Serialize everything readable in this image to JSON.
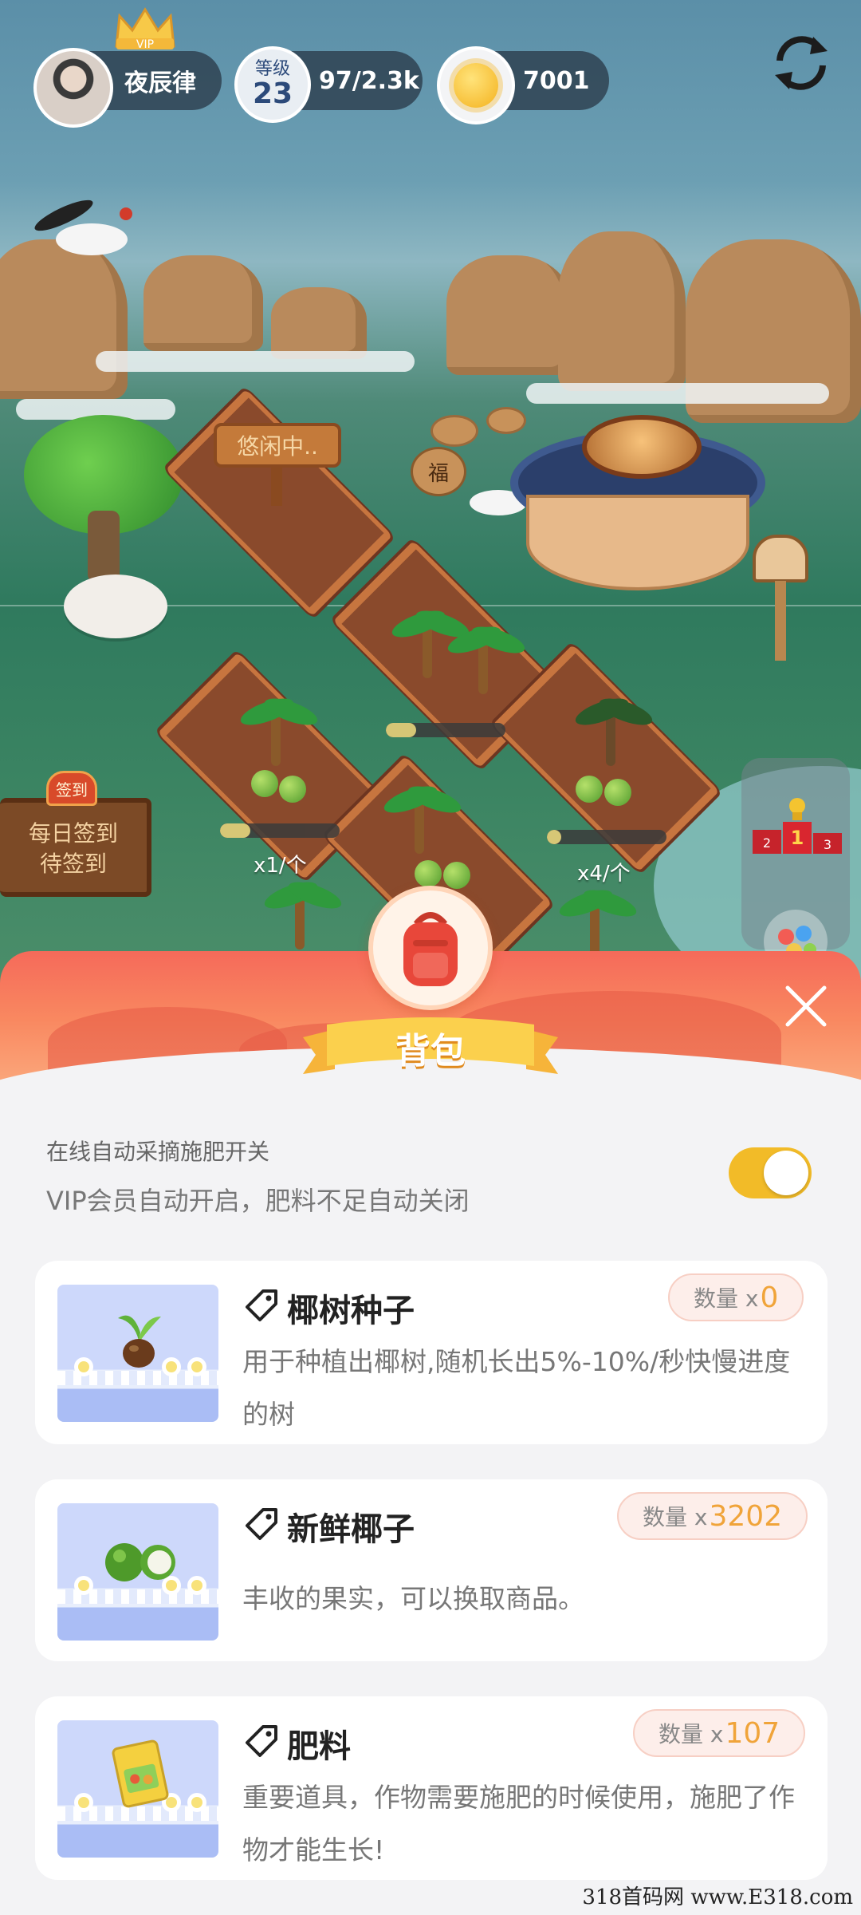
{
  "player": {
    "vip_label": "VIP",
    "name": "夜辰律",
    "level_label": "等级",
    "level": "23",
    "exp": "97/2.3k",
    "coins": "7001"
  },
  "scene": {
    "idle_sign": "悠闲中..",
    "fu_stone": "福",
    "per_label_left": "x1/个",
    "per_label_right": "x4/个",
    "checkin_tag": "签到",
    "checkin_line1": "每日签到",
    "checkin_line2": "待签到",
    "podium_ranks": [
      "2",
      "1",
      "3"
    ],
    "plots_progress": [
      0.25,
      0.25,
      0.12
    ]
  },
  "backpack": {
    "title": "背包",
    "auto_switch_caption": "在线自动采摘施肥开关",
    "auto_switch_desc": "VIP会员自动开启，肥料不足自动关闭",
    "auto_switch_on": true,
    "items": [
      {
        "name": "椰树种子",
        "qty_label": "数量 x",
        "qty": "0",
        "desc": "用于种植出椰树,随机长出5%-10%/秒快慢进度的树",
        "icon": "seed-sprout"
      },
      {
        "name": "新鲜椰子",
        "qty_label": "数量 x",
        "qty": "3202",
        "desc": "丰收的果实，可以换取商品。",
        "icon": "coconut"
      },
      {
        "name": "肥料",
        "qty_label": "数量 x",
        "qty": "107",
        "desc": "重要道具，作物需要施肥的时候使用，施肥了作物才能生长!",
        "icon": "fertilizer-bag"
      }
    ]
  },
  "watermark": "318首码网 www.E318.com",
  "colors": {
    "accent_yellow": "#f2bb28",
    "qty_orange": "#f0a43a",
    "header_red": "#f56a5a"
  }
}
